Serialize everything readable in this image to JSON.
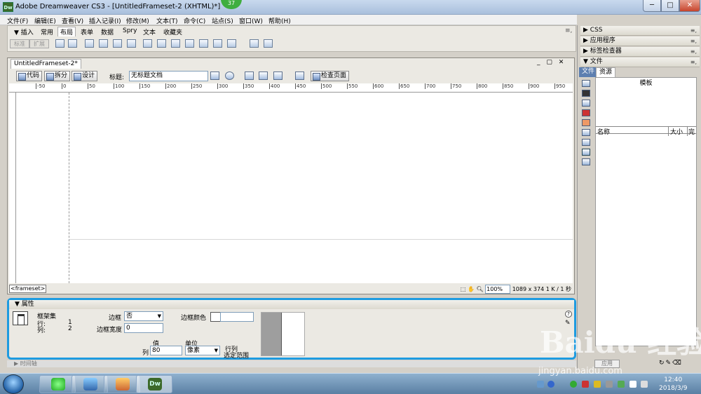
{
  "window": {
    "title": "Adobe Dreamweaver CS3 - [UntitledFrameset-2 (XHTML)*]",
    "app_icon": "Dw",
    "badge": "37",
    "min": "─",
    "max": "□",
    "close": "✕"
  },
  "menu": [
    "文件(F)",
    "编辑(E)",
    "查看(V)",
    "插入记录(I)",
    "修改(M)",
    "文本(T)",
    "命令(C)",
    "站点(S)",
    "窗口(W)",
    "帮助(H)"
  ],
  "insert_panel": {
    "collapse_label": "▼ 插入",
    "tabs": [
      "常用",
      "布局",
      "表单",
      "数据",
      "Spry",
      "文本",
      "收藏夹"
    ],
    "active_tab": "布局",
    "mode_buttons": [
      "标准",
      "扩展"
    ]
  },
  "right_panels": {
    "css": "▶ CSS",
    "app": "▶ 应用程序",
    "tag": "▶ 标签检查器",
    "files": "▼ 文件",
    "tab_files": "文件",
    "tab_assets": "资源",
    "templates_label": "模板",
    "col_name": "名称",
    "col_size": "大小",
    "col_full": "完",
    "apply_button": "应用",
    "options": "≡,"
  },
  "document": {
    "tab_title": "UntitledFrameset-2*",
    "window_controls": "_ ▢ ✕",
    "view_code": "代码",
    "view_split": "拆分",
    "view_design": "设计",
    "title_label": "标题:",
    "title_value": "无标题文档",
    "check_page": "检查页面",
    "ruler_labels": [
      "-50",
      "0",
      "50",
      "100",
      "150",
      "200",
      "250",
      "300",
      "350",
      "400",
      "450",
      "500",
      "550",
      "600",
      "650",
      "700",
      "750",
      "800",
      "850",
      "900",
      "950"
    ],
    "tag_selector": "<frameset>",
    "zoom": "100%",
    "dimensions": "1089 x 374",
    "size_time": "1 K / 1 秒"
  },
  "properties": {
    "header": "▼ 属性",
    "element": "框架集",
    "rows_label": "行:",
    "rows_value": "1",
    "cols_label": "列:",
    "cols_value": "2",
    "border_label": "边框",
    "border_value": "否",
    "border_color_label": "边框颜色",
    "border_color_value": "",
    "border_width_label": "边框宽度",
    "border_width_value": "0",
    "value_label": "值",
    "col_label": "列",
    "col_value": "80",
    "unit_label": "单位",
    "unit_value": "像素",
    "selection_note_1": "行列",
    "selection_note_2": "选定范围"
  },
  "timeline": "▶ 时间轴",
  "taskbar": {
    "time": "12:40",
    "date": "2018/3/9",
    "dw_label": "Dw"
  },
  "watermark": {
    "text": "Baidu 经验",
    "url": "jingyan.baidu.com"
  },
  "colors": {
    "highlight": "#1e9be0",
    "files_tab": "#5d7fb0"
  }
}
